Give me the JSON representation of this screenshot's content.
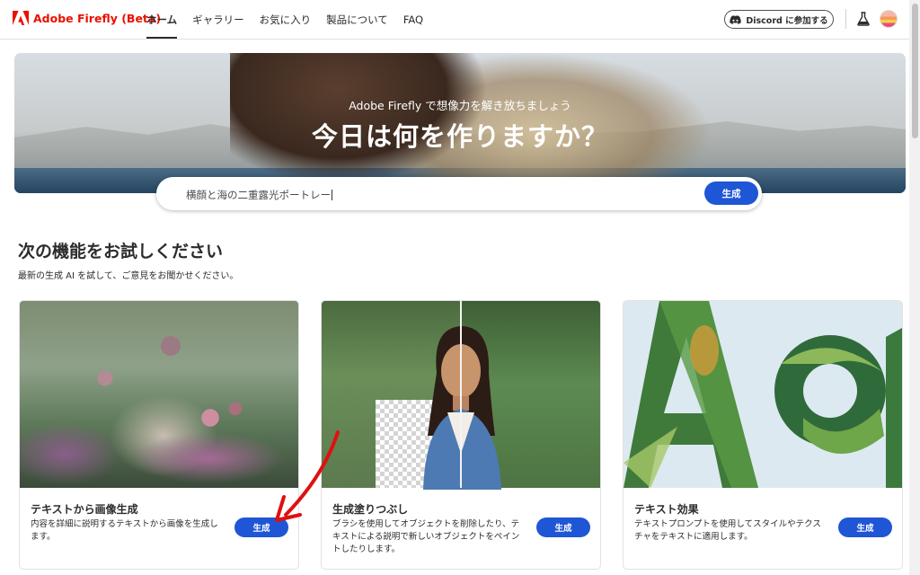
{
  "header": {
    "logo_text": "Adobe Firefly (Beta)",
    "nav": [
      {
        "label": "ホーム",
        "active": true
      },
      {
        "label": "ギャラリー"
      },
      {
        "label": "お気に入り"
      },
      {
        "label": "製品について"
      },
      {
        "label": "FAQ"
      }
    ],
    "discord_label": "Discord に参加する"
  },
  "hero": {
    "subtitle": "Adobe Firefly で想像力を解き放ちましょう",
    "title": "今日は何を作りますか？"
  },
  "search": {
    "value": "横顔と海の二重露光ポートレー",
    "button_label": "生成"
  },
  "section": {
    "title": "次の機能をお試しください",
    "subtitle": "最新の生成 AI を試して、ご意見をお聞かせください。"
  },
  "cards": [
    {
      "title": "テキストから画像生成",
      "description": "内容を詳細に説明するテキストから画像を生成します。",
      "button_label": "生成"
    },
    {
      "title": "生成塗りつぶし",
      "description": "ブラシを使用してオブジェクトを削除したり、テキストによる説明で新しいオブジェクトをペイントしたりします。",
      "button_label": "生成"
    },
    {
      "title": "テキスト効果",
      "description": "テキストプロンプトを使用してスタイルやテクスチャをテキストに適用します。",
      "button_label": "生成"
    }
  ],
  "colors": {
    "brand": "#eb1000",
    "accent": "#1f56d6",
    "annotation_arrow": "#e01010"
  },
  "icons": [
    "adobe-logo-icon",
    "discord-icon",
    "flask-icon",
    "avatar"
  ]
}
